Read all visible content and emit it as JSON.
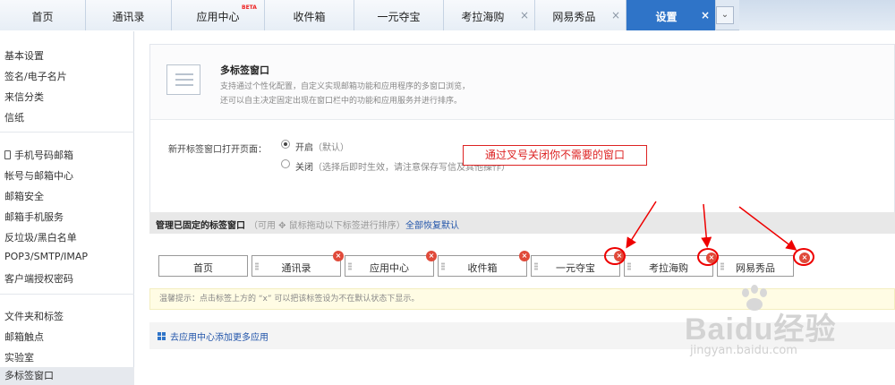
{
  "tabs": [
    {
      "label": "首页",
      "closable": false
    },
    {
      "label": "通讯录",
      "closable": false
    },
    {
      "label": "应用中心",
      "closable": false,
      "badge": "BETA"
    },
    {
      "label": "收件箱",
      "closable": false
    },
    {
      "label": "一元夺宝",
      "closable": false
    },
    {
      "label": "考拉海购",
      "closable": true
    },
    {
      "label": "网易秀品",
      "closable": true
    },
    {
      "label": "设置",
      "closable": true,
      "active": true
    }
  ],
  "tab_close_glyph": "×",
  "tab_more_glyph": "⌄",
  "sidebar": {
    "group1": [
      "基本设置",
      "签名/电子名片",
      "来信分类",
      "信纸"
    ],
    "group2": [
      "手机号码邮箱",
      "帐号与邮箱中心",
      "邮箱安全",
      "邮箱手机服务",
      "反垃圾/黑白名单",
      "POP3/SMTP/IMAP",
      "客户端授权密码"
    ],
    "group3": [
      "文件夹和标签",
      "邮箱触点",
      "实验室",
      "多标签窗口"
    ],
    "current": "多标签窗口"
  },
  "panel": {
    "title": "多标签窗口",
    "desc_line1": "支持通过个性化配置，自定义实现邮箱功能和应用程序的多窗口浏览，",
    "desc_line2": "还可以自主决定固定出现在窗口栏中的功能和应用服务并进行排序。",
    "option_label": "新开标签窗口打开页面：",
    "option_on": "开启",
    "option_on_hint": "（默认）",
    "option_off": "关闭",
    "option_off_hint": "（选择后即时生效，请注意保存写信及其他操作）",
    "selected": "on"
  },
  "callout": "通过叉号关闭你不需要的窗口",
  "manage": {
    "title": "管理已固定的标签窗口",
    "hint": "（可用 ✥ 鼠标拖动以下标签进行排序）",
    "reset_link": "全部恢复默认"
  },
  "pinned_tabs": [
    {
      "label": "首页",
      "closable": false
    },
    {
      "label": "通讯录",
      "closable": true
    },
    {
      "label": "应用中心",
      "closable": true
    },
    {
      "label": "收件箱",
      "closable": true
    },
    {
      "label": "一元夺宝",
      "closable": true,
      "highlighted": true
    },
    {
      "label": "考拉海购",
      "closable": true,
      "highlighted": true
    },
    {
      "label": "网易秀品",
      "closable": true,
      "highlighted": true
    }
  ],
  "tip": "温馨提示：点击标签上方的 “x” 可以把该标签设为不在默认状态下显示。",
  "app_link": "去应用中心添加更多应用",
  "watermark": {
    "brand": "Baidu经验",
    "url": "jingyan.baidu.com"
  },
  "colors": {
    "accent": "#2f74c8",
    "annotation_red": "#e00000",
    "close_red": "#e04a3a",
    "link": "#2255aa"
  }
}
